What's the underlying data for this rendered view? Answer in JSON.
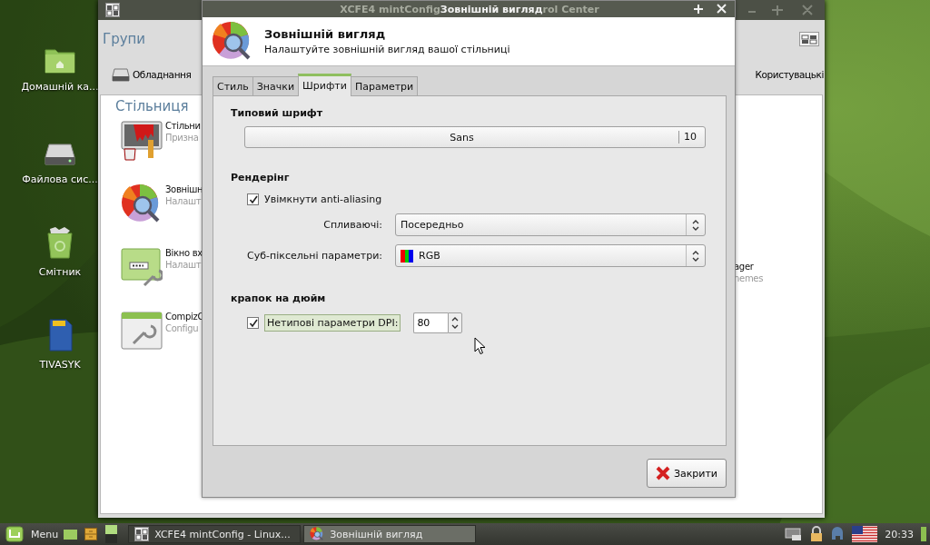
{
  "desktop_icons": [
    {
      "label": "Домашній ка...",
      "kind": "folder"
    },
    {
      "label": "Файлова сис...",
      "kind": "drive"
    },
    {
      "label": "Смітник",
      "kind": "trash"
    },
    {
      "label": "TIVASYK",
      "kind": "card"
    }
  ],
  "control_center": {
    "groups_label": "Групи",
    "categories": [
      {
        "label": "Обладнання"
      },
      {
        "label": "Користувацькі"
      }
    ],
    "section": "Стільниця",
    "items": [
      {
        "name": "Стільни",
        "description": "Призна",
        "kind": "desktop"
      },
      {
        "name": "Зовнішн",
        "description": "Налашт",
        "kind": "appearance"
      },
      {
        "name": "Вікно вх",
        "description": "Налашт",
        "kind": "login"
      },
      {
        "name": "CompizC",
        "description": "Configu",
        "kind": "compiz"
      }
    ],
    "right_items": [
      {
        "name": "ager",
        "description": "nemes"
      }
    ]
  },
  "dialog": {
    "title": "Зовнішній вигляд",
    "underlying_title_parts": [
      "XCFE4 mintConfig",
      "rol Center"
    ],
    "heading": "Зовнішній вигляд",
    "subheading": "Налаштуйте зовнішній вигляд вашої стільниці",
    "tabs": [
      {
        "label": "Стиль",
        "selected": false
      },
      {
        "label": "Значки",
        "selected": false
      },
      {
        "label": "Шрифти",
        "selected": true
      },
      {
        "label": "Параметри",
        "selected": false
      }
    ],
    "default_font": {
      "title": "Типовий шрифт",
      "family": "Sans",
      "size": "10"
    },
    "rendering": {
      "title": "Рендерінг",
      "antialias": {
        "label": "Увімкнути anti-aliasing",
        "checked": true
      },
      "hinting": {
        "label": "Спливаючі:",
        "value": "Посередньо"
      },
      "subpixel": {
        "label": "Суб-піксельні параметри:",
        "value": "RGB"
      }
    },
    "dpi": {
      "title": "крапок на дюйм",
      "label": "Нетипові параметри DPI:",
      "checked": true,
      "value": "80"
    },
    "close_button": "Закрити"
  },
  "taskbar": {
    "menu": "Menu",
    "tasks": [
      {
        "label": "XCFE4 mintConfig - Linux...",
        "kind": "control",
        "selected": false
      },
      {
        "label": "Зовнішній вигляд",
        "kind": "appearance",
        "selected": true
      }
    ],
    "clock": "20:33"
  }
}
